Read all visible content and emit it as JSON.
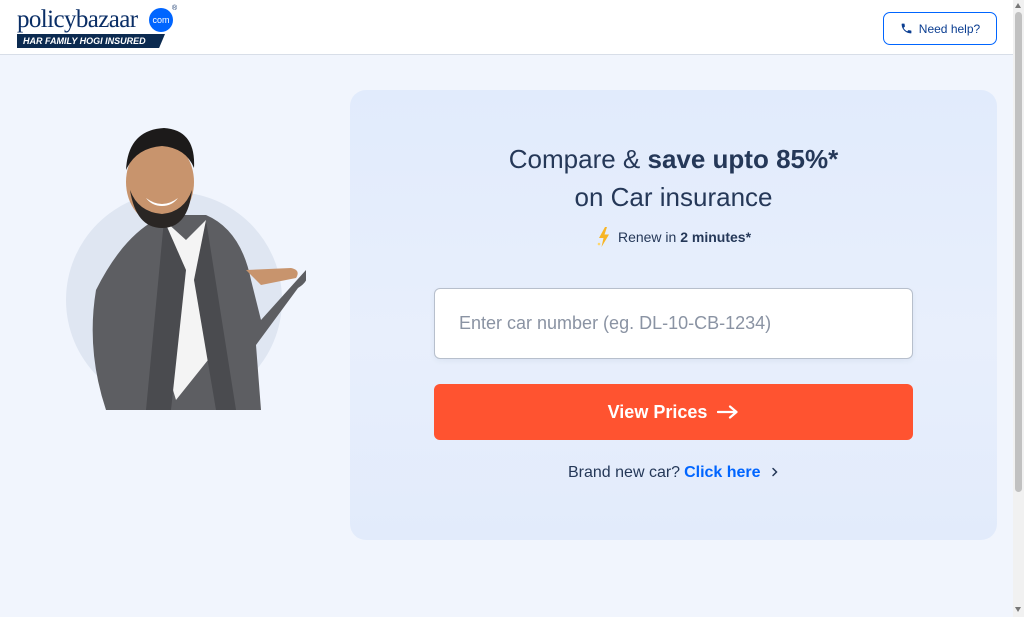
{
  "brand": {
    "logo_word_policy": "policy",
    "logo_word_bazaar": "bazaar",
    "logo_com": "com",
    "logo_reg": "®",
    "tagline": "HAR FAMILY HOGI INSURED"
  },
  "header": {
    "help_label": "Need help?",
    "help_icon": "phone-icon"
  },
  "hero": {
    "headline_light": "Compare & ",
    "headline_strong": "save upto 85%*",
    "headline_line2": "on Car insurance",
    "renew_prefix": "Renew in ",
    "renew_strong": "2 minutes*",
    "renew_icon": "lightning-icon"
  },
  "form": {
    "car_number_placeholder": "Enter car number (eg. DL-10-CB-1234)",
    "car_number_value": "",
    "submit_label": "View Prices",
    "submit_icon": "arrow-right-icon"
  },
  "footer_link": {
    "prefix": "Brand new car?",
    "link_label": "Click here",
    "link_icon": "chevron-right-icon"
  },
  "colors": {
    "accent": "#0065ff",
    "cta": "#ff5330",
    "text": "#253858",
    "page_bg": "#f1f5fd"
  }
}
